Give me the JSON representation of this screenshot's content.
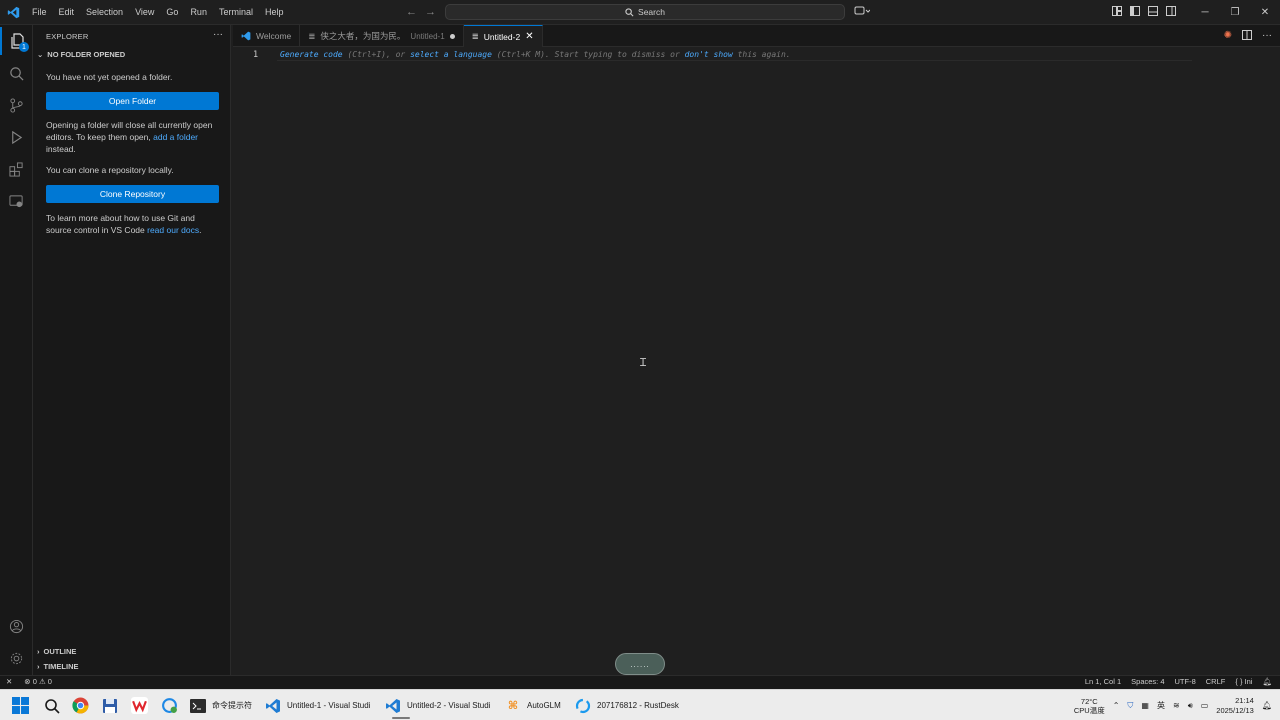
{
  "menu": [
    "File",
    "Edit",
    "Selection",
    "View",
    "Go",
    "Run",
    "Terminal",
    "Help"
  ],
  "search": {
    "label": "Search"
  },
  "explorer": {
    "header": "EXPLORER",
    "section": "NO FOLDER OPENED",
    "no_folder_text": "You have not yet opened a folder.",
    "open_folder_button": "Open Folder",
    "warning_text_1": "Opening a folder will close all currently open",
    "warning_text_2_prefix": "editors. To keep them open, ",
    "warning_link": "add a folder",
    "warning_text_3": "instead.",
    "clone_text": "You can clone a repository locally.",
    "clone_button": "Clone Repository",
    "git_text_1": "To learn more about how to use Git and",
    "git_text_2_prefix": "source control in VS Code ",
    "git_link": "read our docs",
    "git_text_2_suffix": ".",
    "outline": "OUTLINE",
    "timeline": "TIMELINE"
  },
  "activity_badge": "1",
  "tabs": [
    {
      "label": "Welcome",
      "desc": ""
    },
    {
      "label": "侠之大者，为国为民。",
      "desc": "Untitled-1"
    },
    {
      "label": "Untitled-2",
      "desc": ""
    }
  ],
  "editor": {
    "line_number": "1",
    "hint_link_1": "Generate code",
    "hint_1": " (Ctrl+I), or ",
    "hint_link_2": "select a language",
    "hint_2": " (Ctrl+K M). Start typing to dismiss or ",
    "hint_link_3": "don't show",
    "hint_3": " this again.",
    "pill": "......"
  },
  "status": {
    "errors": "0",
    "warnings": "0",
    "position": "Ln 1, Col 1",
    "spaces": "Spaces: 4",
    "encoding": "UTF-8",
    "eol": "CRLF",
    "language": "{ } Ini"
  },
  "taskbar": {
    "cmd": "命令提示符",
    "vscode1": "Untitled-1 - Visual Studi",
    "vscode2": "Untitled-2 - Visual Studi",
    "autoglm": "AutoGLM",
    "rustdesk": "207176812 - RustDesk",
    "cpu_temp": "72°C",
    "cpu_label": "CPU温度",
    "time": "21:14",
    "date": "2025/12/13"
  },
  "colors": {
    "accent": "#0078d4",
    "link": "#4daafc",
    "bg": "#1f1f1f",
    "panel": "#181818"
  }
}
